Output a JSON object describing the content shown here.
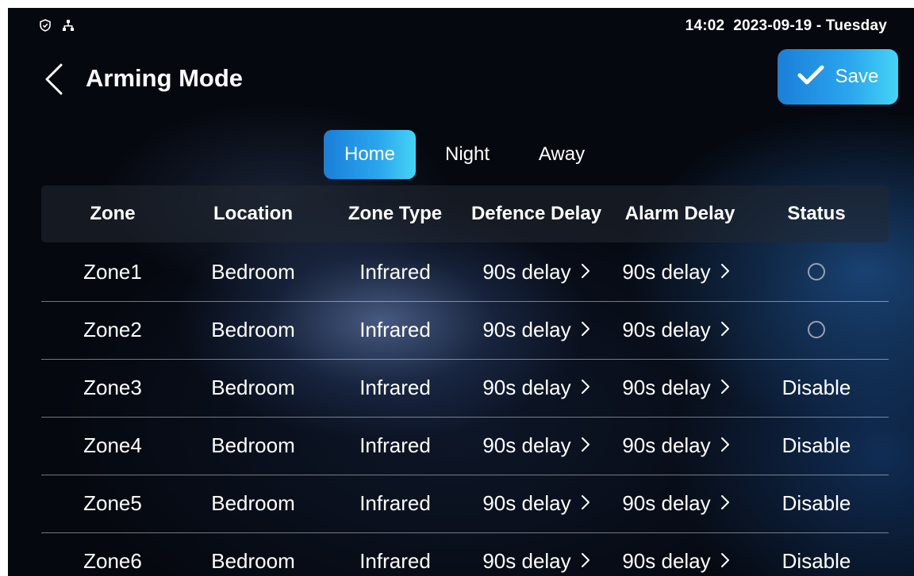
{
  "status_bar": {
    "icons": [
      "shield-icon",
      "network-icon"
    ],
    "time": "14:02",
    "date": "2023-09-19 - Tuesday"
  },
  "header": {
    "back_icon": "chevron-left-icon",
    "title": "Arming Mode",
    "save_label": "Save",
    "save_icon": "checkmark-icon"
  },
  "tabs": [
    {
      "label": "Home",
      "active": true
    },
    {
      "label": "Night",
      "active": false
    },
    {
      "label": "Away",
      "active": false
    }
  ],
  "table": {
    "columns": [
      "Zone",
      "Location",
      "Zone Type",
      "Defence Delay",
      "Alarm Delay",
      "Status"
    ],
    "rows": [
      {
        "zone": "Zone1",
        "location": "Bedroom",
        "type": "Infrared",
        "defence_delay": "90s delay",
        "alarm_delay": "90s delay",
        "status": "",
        "status_kind": "radio-unchecked"
      },
      {
        "zone": "Zone2",
        "location": "Bedroom",
        "type": "Infrared",
        "defence_delay": "90s delay",
        "alarm_delay": "90s delay",
        "status": "",
        "status_kind": "radio-unchecked"
      },
      {
        "zone": "Zone3",
        "location": "Bedroom",
        "type": "Infrared",
        "defence_delay": "90s delay",
        "alarm_delay": "90s delay",
        "status": "Disable",
        "status_kind": "text"
      },
      {
        "zone": "Zone4",
        "location": "Bedroom",
        "type": "Infrared",
        "defence_delay": "90s delay",
        "alarm_delay": "90s delay",
        "status": "Disable",
        "status_kind": "text"
      },
      {
        "zone": "Zone5",
        "location": "Bedroom",
        "type": "Infrared",
        "defence_delay": "90s delay",
        "alarm_delay": "90s delay",
        "status": "Disable",
        "status_kind": "text"
      },
      {
        "zone": "Zone6",
        "location": "Bedroom",
        "type": "Infrared",
        "defence_delay": "90s delay",
        "alarm_delay": "90s delay",
        "status": "Disable",
        "status_kind": "text"
      }
    ]
  },
  "colors": {
    "accent_start": "#1a7fd8",
    "accent_end": "#45d4f5",
    "background": "#05080f",
    "radio": "#9aa2ad"
  }
}
